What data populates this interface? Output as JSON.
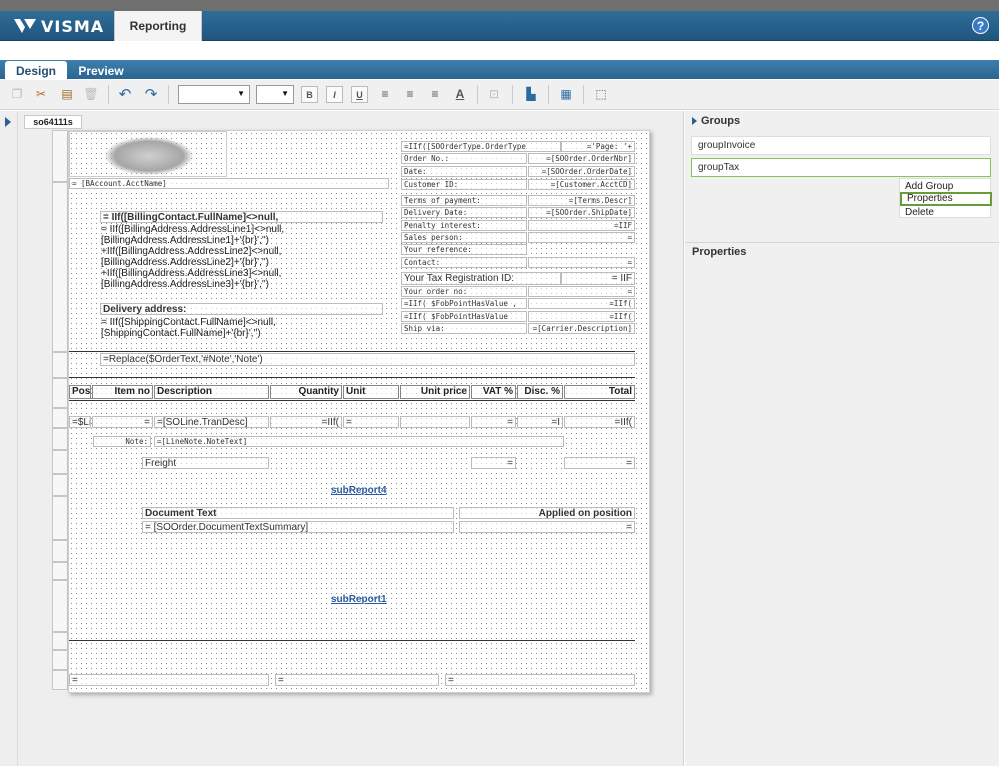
{
  "app": {
    "brand": "VISMA",
    "module_tab": "Reporting",
    "help_icon": "?"
  },
  "tabs": {
    "design": "Design",
    "preview": "Preview"
  },
  "toolbar": {
    "icons": [
      "copy-icon",
      "cut-icon",
      "paste-icon",
      "delete-icon",
      "undo-icon",
      "redo-icon",
      "bold-icon",
      "italic-icon",
      "underline-icon",
      "align-left-icon",
      "align-center-icon",
      "align-right-icon",
      "text-color-icon",
      "fit-icon",
      "align-elements-icon",
      "grid-icon",
      "border-icon"
    ],
    "bold": "B",
    "italic": "I",
    "underline": "U"
  },
  "report": {
    "tab": "so64111s",
    "header_fields": {
      "acct": "= [BAccount.AcctName]",
      "iif_order": "=IIf([SOOrderType.OrderType",
      "page": "='Page: '+",
      "order_no_lbl": "Order No.:",
      "order_no": "=[SOOrder.OrderNbr]",
      "date_lbl": "Date:",
      "date": "=[SOOrder.OrderDate]",
      "cust_lbl": "Customer ID:",
      "cust": "=[Customer.AcctCD]",
      "terms_lbl": "Terms of payment:",
      "terms": "=[Terms.Descr]",
      "deliv_lbl": "Delivery Date:",
      "deliv": "=[SOOrder.ShipDate]",
      "penalty_lbl": "Penalty interest:",
      "penalty": "=IIF",
      "sales_lbl": "Sales person:",
      "sales": "=",
      "yourref_lbl": "Your reference:",
      "contact_lbl": "Contact:",
      "contact": "=",
      "taxreg_lbl": "Your Tax Registration ID:",
      "taxreg": "= IIF",
      "yourorder_lbl": "Your order no:",
      "yourorder": "=",
      "fob1": "=IIf( $FobPointHasValue ,",
      "fob1v": "=IIf(",
      "fob2": "=IIf( $FobPointHasValue",
      "fob2v": "=IIf(",
      "shipvia_lbl": "Ship via:",
      "shipvia": "=[Carrier.Description]"
    },
    "address": {
      "billing_name": "= IIf([BillingContact.FullName]<>null,",
      "line1": "= IIf([BillingAddress.AddressLine1]<>null,",
      "line2": "[BillingAddress.AddressLine1]+'{br}','')",
      "line3": "+IIf([BillingAddress.AddressLine2]<>null,",
      "line4": "[BillingAddress.AddressLine2]+'{br}','')",
      "line5": "+IIf([BillingAddress.AddressLine3]<>null,",
      "line6": "[BillingAddress.AddressLine3]+'{br}','')",
      "delivery_lbl": "Delivery address:",
      "ship1": "= IIf([ShippingContact.FullName]<>null,",
      "ship2": "[ShippingContact.FullName]+'{br}','')"
    },
    "order_text": "=Replace($OrderText,'#Note','Note')",
    "columns": [
      "Pos",
      "Item no",
      "Description",
      "Quantity",
      "Unit",
      "Unit price",
      "VAT %",
      "Disc. %",
      "Total"
    ],
    "detail": {
      "pos": "=$Li",
      "item": "=",
      "desc": "=[SOLine.TranDesc]",
      "qty": "=IIf(",
      "unit": "=",
      "vat": "=",
      "disc": "=I",
      "total": "=IIf(",
      "note_lbl": "Note:",
      "note": "=[LineNote.NoteText]"
    },
    "freight": {
      "label": "Freight",
      "qty": "=",
      "total": "="
    },
    "subreport4": "subReport4",
    "doc_text": {
      "label": "Document Text",
      "applied": "Applied on position",
      "value": "= [SOOrder.DocumentTextSummary]",
      "value2": "="
    },
    "subreport1": "subReport1",
    "footer": {
      "f1": "=",
      "f2": "=",
      "f3": "="
    }
  },
  "groups": {
    "title": "Groups",
    "items": [
      "groupInvoice",
      "groupTax"
    ],
    "menu": [
      "Add Group",
      "Properties",
      "Delete"
    ]
  },
  "properties": {
    "title": "Properties"
  }
}
